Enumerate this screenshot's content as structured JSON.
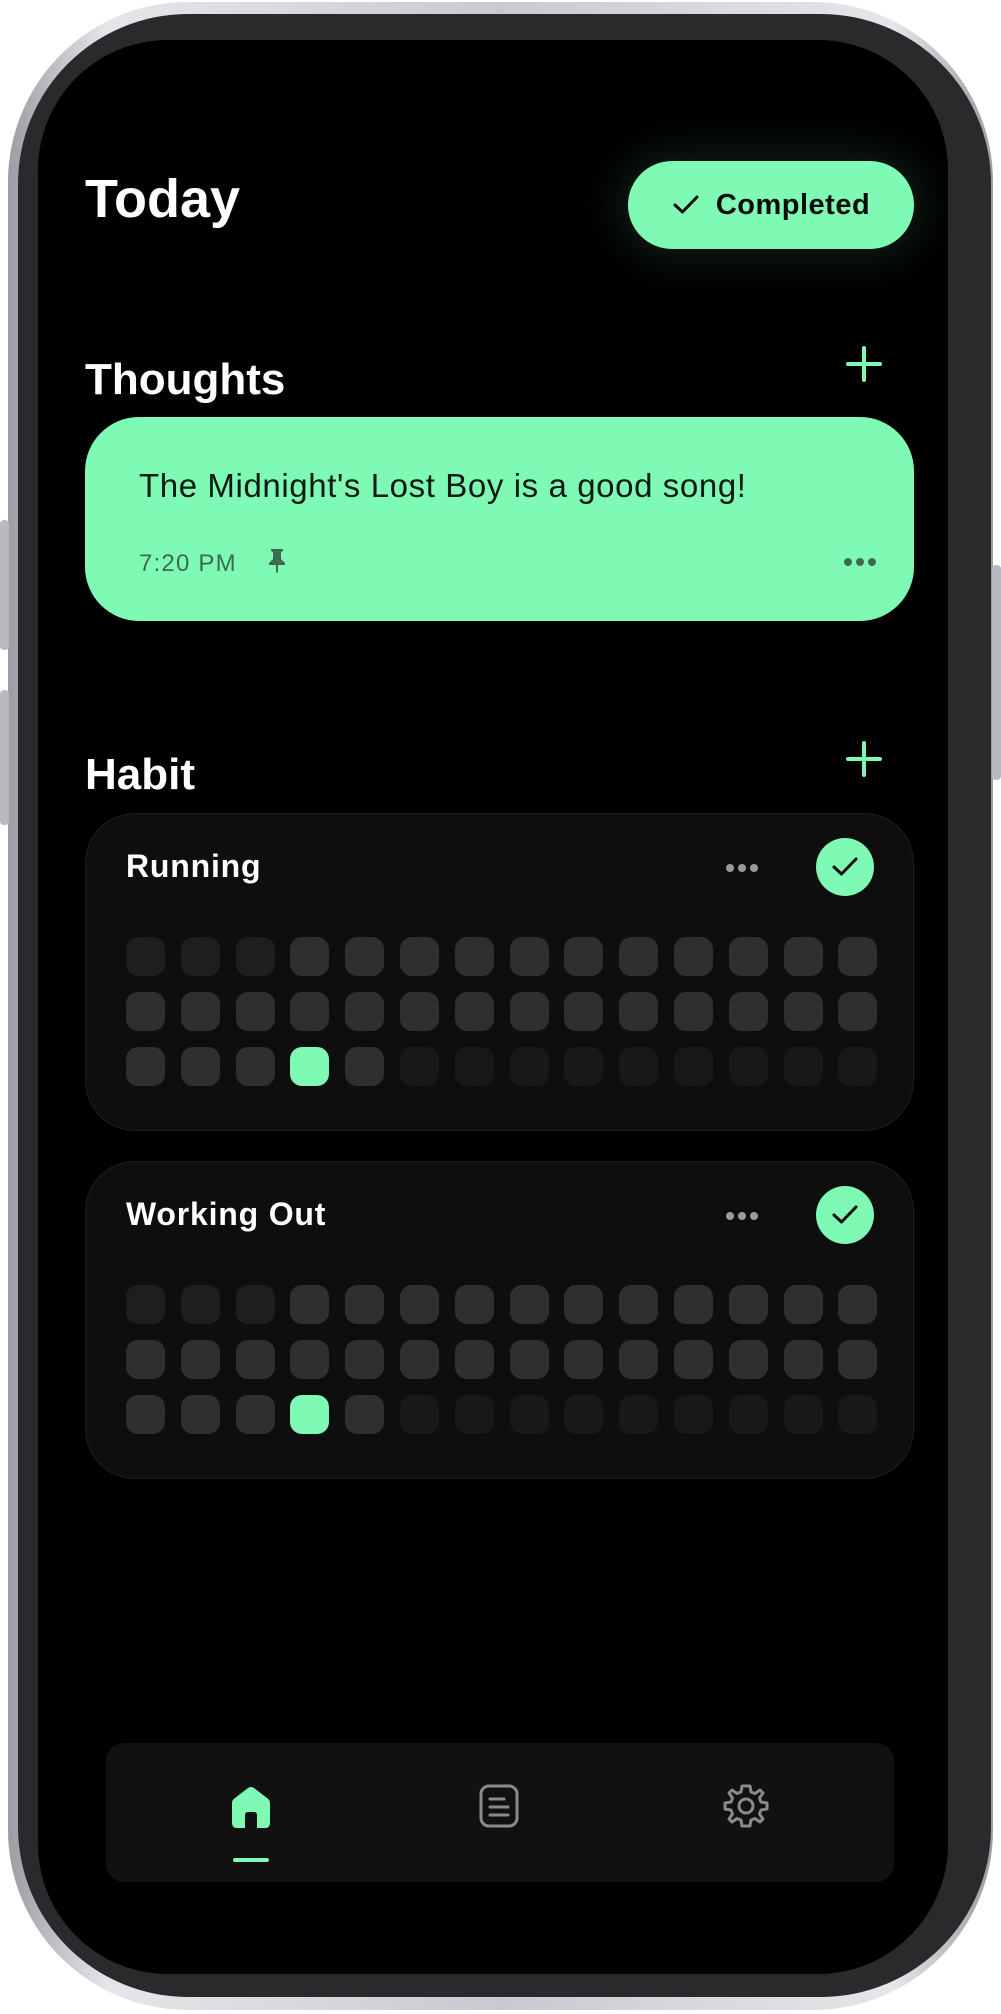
{
  "header": {
    "title": "Today",
    "completed_label": "Completed"
  },
  "thoughts": {
    "title": "Thoughts",
    "items": [
      {
        "text": "The Midnight's Lost Boy is a good song!",
        "time": "7:20 PM",
        "pinned": true
      }
    ]
  },
  "habit": {
    "title": "Habit",
    "items": [
      {
        "name": "Running",
        "completed": true,
        "grid_levels": [
          [
            0,
            0,
            0,
            1,
            1,
            1,
            1,
            1,
            1,
            1,
            1,
            1,
            1,
            1
          ],
          [
            1,
            1,
            1,
            1,
            1,
            1,
            1,
            1,
            1,
            1,
            1,
            1,
            1,
            1
          ],
          [
            1,
            1,
            1,
            3,
            1,
            2,
            2,
            2,
            2,
            2,
            2,
            2,
            2,
            2
          ]
        ]
      },
      {
        "name": "Working Out",
        "completed": true,
        "grid_levels": [
          [
            0,
            0,
            0,
            1,
            1,
            1,
            1,
            1,
            1,
            1,
            1,
            1,
            1,
            1
          ],
          [
            1,
            1,
            1,
            1,
            1,
            1,
            1,
            1,
            1,
            1,
            1,
            1,
            1,
            1
          ],
          [
            1,
            1,
            1,
            3,
            1,
            2,
            2,
            2,
            2,
            2,
            2,
            2,
            2,
            2
          ]
        ]
      }
    ]
  },
  "nav": {
    "tabs": [
      {
        "name": "home",
        "icon": "home-icon",
        "active": true
      },
      {
        "name": "notes",
        "icon": "document-icon",
        "active": false
      },
      {
        "name": "settings",
        "icon": "gear-icon",
        "active": false
      }
    ]
  },
  "colors": {
    "accent": "#7efab4",
    "background": "#000000",
    "card": "#0e0e0e"
  }
}
